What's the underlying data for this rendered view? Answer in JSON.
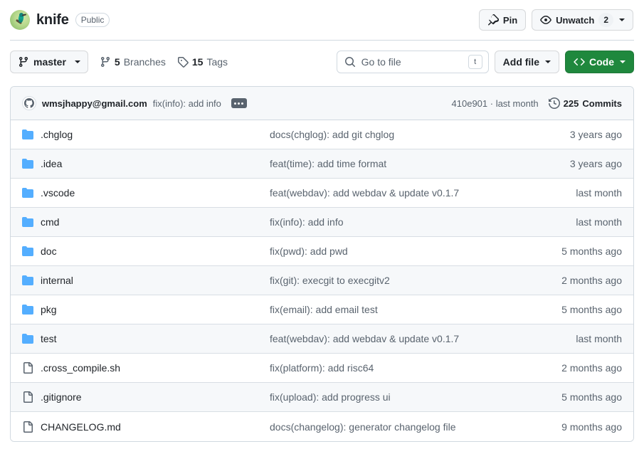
{
  "header": {
    "repo_name": "knife",
    "visibility": "Public",
    "avatar_icon": "hummingbird-avatar",
    "pin_button": "Pin",
    "pin_icon": "pin-icon",
    "watch_button": "Unwatch",
    "watch_icon": "eye-icon",
    "watch_count": "2"
  },
  "toolbar": {
    "branch_name": "master",
    "branch_icon": "git-branch-icon",
    "branches_count": "5",
    "branches_label": "Branches",
    "tags_count": "15",
    "tags_label": "Tags",
    "tag_icon": "tag-icon",
    "search_placeholder": "Go to file",
    "search_value": "",
    "search_icon": "search-icon",
    "search_shortcut": "t",
    "add_file_label": "Add file",
    "code_label": "Code",
    "code_icon": "code-brackets-icon"
  },
  "commit_bar": {
    "avatar_icon": "github-mark-icon",
    "author": "wmsjhappy@gmail.com",
    "message": "fix(info): add info",
    "expand_icon": "ellipsis-icon",
    "sha_and_date": "410e901 · last month",
    "history_icon": "history-icon",
    "commits_count": "225",
    "commits_label": "Commits"
  },
  "files": [
    {
      "name": ".chglog",
      "type": "folder",
      "message": "docs(chglog): add git chglog",
      "time": "3 years ago"
    },
    {
      "name": ".idea",
      "type": "folder",
      "message": "feat(time): add time format",
      "time": "3 years ago"
    },
    {
      "name": ".vscode",
      "type": "folder",
      "message": "feat(webdav): add webdav & update v0.1.7",
      "time": "last month"
    },
    {
      "name": "cmd",
      "type": "folder",
      "message": "fix(info): add info",
      "time": "last month"
    },
    {
      "name": "doc",
      "type": "folder",
      "message": "fix(pwd): add pwd",
      "time": "5 months ago"
    },
    {
      "name": "internal",
      "type": "folder",
      "message": "fix(git): execgit to execgitv2",
      "time": "2 months ago"
    },
    {
      "name": "pkg",
      "type": "folder",
      "message": "fix(email): add email test",
      "time": "5 months ago"
    },
    {
      "name": "test",
      "type": "folder",
      "message": "feat(webdav): add webdav & update v0.1.7",
      "time": "last month"
    },
    {
      "name": ".cross_compile.sh",
      "type": "file",
      "message": "fix(platform): add risc64",
      "time": "2 months ago"
    },
    {
      "name": ".gitignore",
      "type": "file",
      "message": "fix(upload): add progress ui",
      "time": "5 months ago"
    },
    {
      "name": "CHANGELOG.md",
      "type": "file",
      "message": "docs(changelog): generator changelog file",
      "time": "9 months ago"
    }
  ],
  "colors": {
    "accent_green": "#1f883d",
    "folder_blue": "#54aeff",
    "text_primary": "#1f2328",
    "text_muted": "#59636e",
    "border": "#d1d9e0",
    "row_alt_bg": "#f6f8fa"
  }
}
